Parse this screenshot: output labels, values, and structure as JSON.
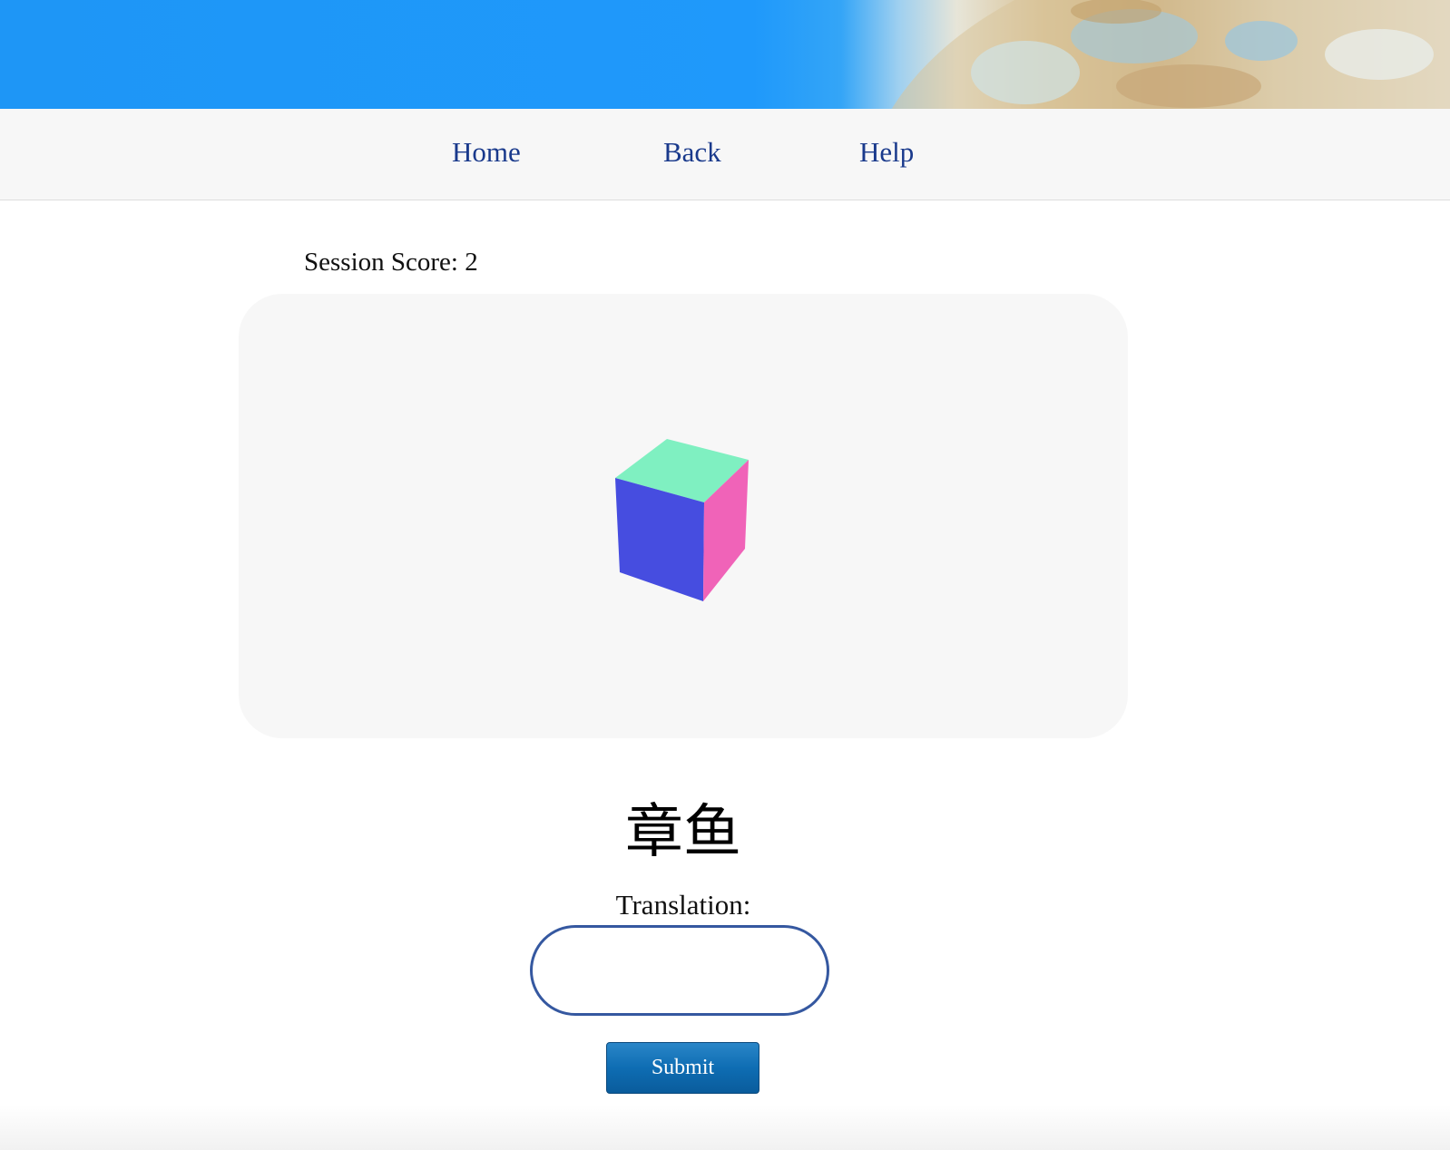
{
  "nav": {
    "home": "Home",
    "back": "Back",
    "help": "Help"
  },
  "session": {
    "score_label": "Session Score:",
    "score_value": "2",
    "score_text": "Session Score: 2"
  },
  "quiz": {
    "word": "章鱼",
    "translation_label": "Translation:",
    "answer_value": "",
    "answer_placeholder": "",
    "submit_label": "Submit"
  },
  "cube": {
    "top_color": "#7ff0c1",
    "front_color": "#464de0",
    "side_color": "#f063b8"
  },
  "colors": {
    "banner_blue": "#1f99fb",
    "nav_link": "#1a3a8c",
    "input_border": "#3558a0",
    "button_blue": "#0e6db3"
  }
}
